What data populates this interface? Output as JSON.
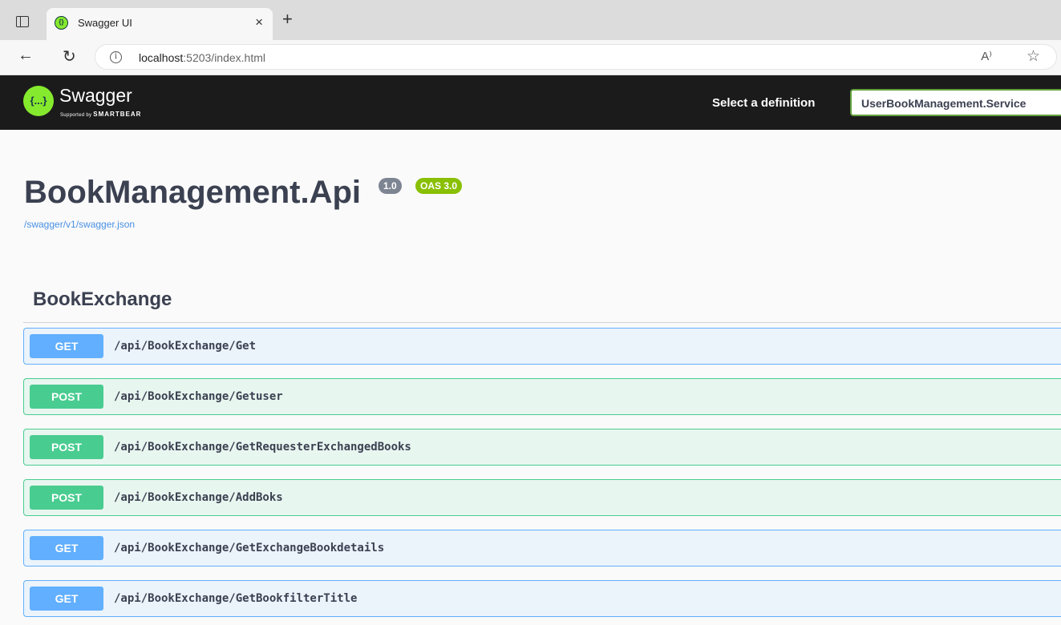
{
  "browser": {
    "tab_title": "Swagger UI",
    "tab_close": "×",
    "new_tab": "+",
    "url_host": "localhost",
    "url_rest": ":5203/index.html",
    "read_aloud": "A⁾"
  },
  "topbar": {
    "logo_mark": "{...}",
    "logo_word": "Swagger",
    "logo_sub_prefix": "Supported by ",
    "logo_sub_brand": "SMARTBEAR",
    "definition_label": "Select a definition",
    "definition_value": "UserBookManagement.Service"
  },
  "info": {
    "title": "BookManagement.Api",
    "version": "1.0",
    "oas": "OAS 3.0",
    "spec_url": "/swagger/v1/swagger.json"
  },
  "section": {
    "title": "BookExchange",
    "operations": [
      {
        "method": "GET",
        "path": "/api/BookExchange/Get"
      },
      {
        "method": "POST",
        "path": "/api/BookExchange/Getuser"
      },
      {
        "method": "POST",
        "path": "/api/BookExchange/GetRequesterExchangedBooks"
      },
      {
        "method": "POST",
        "path": "/api/BookExchange/AddBoks"
      },
      {
        "method": "GET",
        "path": "/api/BookExchange/GetExchangeBookdetails"
      },
      {
        "method": "GET",
        "path": "/api/BookExchange/GetBookfilterTitle"
      }
    ]
  },
  "colors": {
    "get": "#61affe",
    "post": "#49cc90",
    "topbar": "#1b1b1b",
    "logo": "#85ea2d"
  }
}
